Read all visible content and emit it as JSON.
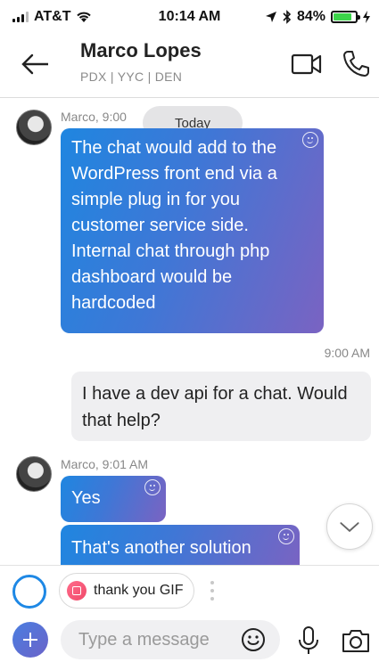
{
  "status_bar": {
    "carrier": "AT&T",
    "time": "10:14 AM",
    "battery_percent": "84%",
    "battery_level": 0.84,
    "battery_color": "#3cd44a"
  },
  "header": {
    "title": "Marco Lopes",
    "subtitle": "PDX | YYC | DEN",
    "back_icon": "arrow-left-icon",
    "video_icon": "video-camera-icon",
    "call_icon": "phone-icon"
  },
  "chat": {
    "today_label": "Today",
    "messages": [
      {
        "sender_label": "Marco, 9:00",
        "text": "The chat would add to the WordPress front end via a simple plug in for you customer service side. Internal chat through php dashboard would be hardcoded"
      },
      {
        "timestamp": "9:00 AM",
        "text": "I have a dev api for a chat. Would that help?"
      },
      {
        "sender_label": "Marco, 9:01 AM",
        "text": "Yes"
      },
      {
        "text": "That's another solution"
      }
    ]
  },
  "suggestions": {
    "chip_label": "thank you GIF",
    "chip_icon": "gif-icon"
  },
  "composer": {
    "placeholder": "Type a message",
    "accent": "#1e88e5"
  }
}
